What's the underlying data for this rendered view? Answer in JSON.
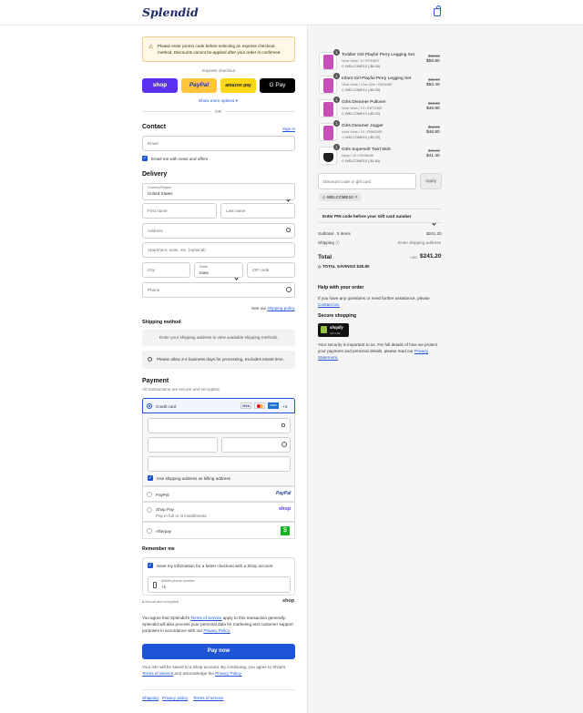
{
  "header": {
    "logo": "Splendid"
  },
  "notice": {
    "text": "Please enter promo code before selecting an express checkout method. Discounts cannot be applied after your order is confirmed."
  },
  "express": {
    "heading": "Express checkout",
    "buttons": [
      "shop",
      "PayPal",
      "amazon pay",
      "G Pay"
    ],
    "more": "Show more options",
    "or": "OR"
  },
  "contact": {
    "heading": "Contact",
    "sign_in": "Sign in",
    "email_placeholder": "Email",
    "news": "Email me with news and offers"
  },
  "delivery": {
    "heading": "Delivery",
    "country_label": "Country/Region",
    "country_value": "United States",
    "first_name": "First name",
    "last_name": "Last name",
    "address": "Address",
    "apartment": "Apartment, suite, etc. (optional)",
    "city": "City",
    "state_label": "State",
    "state_value": "Iowa",
    "zip": "ZIP code",
    "phone": "Phone",
    "see_our": "See our",
    "shipping_policy": "shipping policy"
  },
  "shipping_method": {
    "heading": "Shipping method",
    "placeholder": "Enter your shipping address to view available shipping methods.",
    "note": "Please allow 2-4 business days for processing, excludes transit time."
  },
  "payment": {
    "heading": "Payment",
    "subheading": "All transactions are secure and encrypted.",
    "credit_card": "Credit card",
    "card_brands": [
      "VISA",
      "MC",
      "AMEX"
    ],
    "more_brands": "+3",
    "billing_same": "Use shipping address as billing address",
    "paypal": "PayPal",
    "paypal_logo": "PayPal",
    "shop_pay": "Shop Pay",
    "shop_pay_sub": "Pay in full or in installments",
    "shop_pay_logo": "shop",
    "afterpay": "Afterpay"
  },
  "remember": {
    "heading": "Remember me",
    "save_info": "Save my information for a faster checkout with a Shop account",
    "mobile_label": "Mobile phone number",
    "mobile_value": "+1",
    "secure": "Secure and encrypted",
    "shop_logo": "shop"
  },
  "terms": {
    "text1": "You agree that Splendid's",
    "tos": "Terms of Service",
    "text2": "apply to this transaction generally. Splendid will also process your personal data for marketing and customer support purposes in accordance with our",
    "privacy": "Privacy Policy."
  },
  "pay_now": "Pay now",
  "shop_note": {
    "text1": "Your info will be saved to a Shop account. By continuing, you agree to Shop's",
    "tos": "Terms of Service",
    "text2": "and acknowledge the",
    "privacy": "Privacy Policy."
  },
  "footer": {
    "links": [
      "Shipping",
      "Privacy policy",
      "Terms of service"
    ]
  },
  "cart": {
    "items": [
      {
        "qty": "1",
        "name": "Toddler Girl Playful Perry Legging Set",
        "variant": "Vivid Viola / 3 / RT04897",
        "discount": "WELCOME10 (-$6.05)",
        "was": "$60.50",
        "price": "$55.80"
      },
      {
        "qty": "1",
        "name": "Infant Girl Playful Perry Legging Set",
        "variant": "Vivid Viola / 12m-18m / RN04887",
        "discount": "WELCOME10 (-$6.05)",
        "was": "$55.00",
        "price": "$50.40"
      },
      {
        "qty": "1",
        "name": "Girls Dreamer Pullover",
        "variant": "Vivid Viola / 10 / RKT0360",
        "discount": "WELCOME10 (-$5.20)",
        "was": "$52.00",
        "price": "$46.80"
      },
      {
        "qty": "1",
        "name": "Girls Dreamer Jogger",
        "variant": "Vivid Viola / 10 / RI860360",
        "discount": "WELCOME10 (-$5.20)",
        "was": "$52.00",
        "price": "$46.80"
      },
      {
        "qty": "1",
        "name": "Girls Supersoft Twirl Skirt",
        "variant": "Navy / 10 / RK96499",
        "discount": "WELCOME10 (-$4.60)",
        "was": "$46.00",
        "price": "$41.40"
      }
    ],
    "discount_placeholder": "Discount code or gift card",
    "apply": "Apply",
    "applied_code": "WELCOME10",
    "pin_prompt": "Enter PIN code before your Gift card number",
    "subtotal_label": "Subtotal · 5 items",
    "subtotal_value": "$241.20",
    "shipping_label": "Shipping",
    "shipping_value": "Enter shipping address",
    "total_label": "Total",
    "currency": "USD",
    "total_value": "$241.20",
    "savings_label": "TOTAL SAVINGS",
    "savings_value": "$26.80"
  },
  "help": {
    "heading": "Help with your order",
    "text": "If you have any questions or need further assistance, please",
    "contact": "Contact Us.",
    "secure_heading": "Secure shopping",
    "badge_top": "shopify",
    "badge_bottom": "SECURE",
    "secure_text": "Your security is important to us. For full details of how we protect your payment and personal details, please read our",
    "privacy": "Privacy Statement."
  },
  "colors": {
    "accent": "#1e54d6",
    "warning_bg": "#fff7e8",
    "shop_purple": "#5a31f4",
    "paypal_yellow": "#ffc439",
    "afterpay_green": "#14b31f"
  }
}
